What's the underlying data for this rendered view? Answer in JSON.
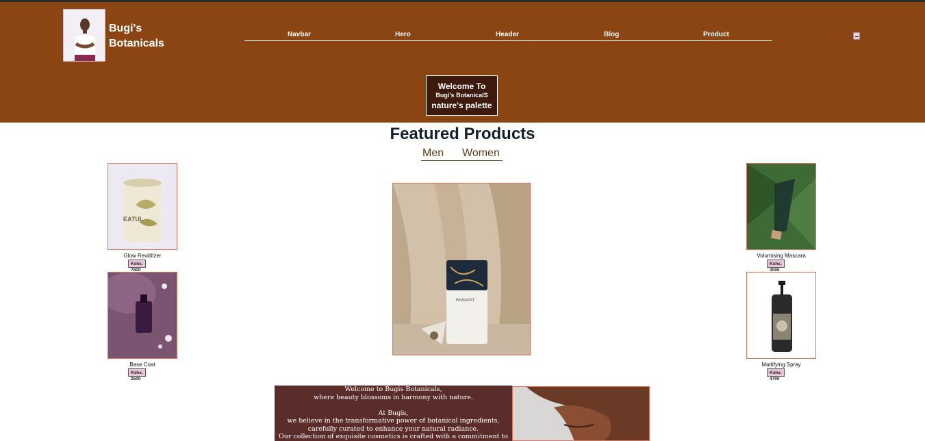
{
  "brand": {
    "name_line1": "Bugi's",
    "name_line2": "Botanicals"
  },
  "nav": {
    "items": [
      "Navbar",
      "Hero",
      "Header",
      "Blog",
      "Product"
    ]
  },
  "hero": {
    "line1": "Welcome To",
    "line2": "Bugi's BotanicalS",
    "line3": "nature's palette"
  },
  "featured": {
    "title": "Featured Products",
    "tabs": [
      "Men",
      "Women"
    ]
  },
  "products": [
    {
      "name": "Glow Revitilizer",
      "price": "Kshs. 7800"
    },
    {
      "name": "Base Coat",
      "price": "Kshs. 2500"
    },
    {
      "name": "Volumising Mascara",
      "price": "Kshs. 3000"
    },
    {
      "name": "Mattifying Spray",
      "price": "Kshs. 4700"
    }
  ],
  "about": {
    "lines": [
      "Welcome to Bugis Botanicals,",
      "where beauty blossoms in harmony with nature.",
      "",
      "At Bugis,",
      "we believe in the transformative power of botanical ingredients,",
      "carefully curated to enhance your natural radiance.",
      "Our collection of exquisite cosmetics is crafted with a commitment to purity,"
    ]
  },
  "colors": {
    "header_bg": "#8b4513",
    "hero_box": "#3d1a0c",
    "accent_border": "#e0755c",
    "price_bg": "#eac6d8",
    "about_bg": "#5b2d2a"
  }
}
